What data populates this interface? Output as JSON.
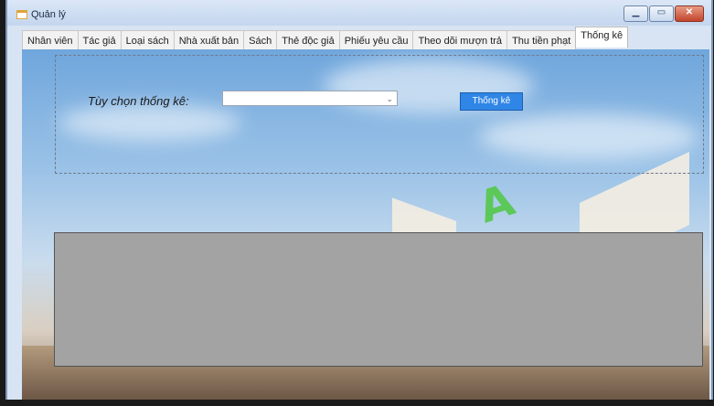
{
  "window": {
    "title": "Quản lý",
    "icon": "app-form-icon",
    "controls": [
      "minimize-icon",
      "maximize-icon",
      "close-icon"
    ]
  },
  "tabs": [
    {
      "label": "Nhân viên",
      "active": false
    },
    {
      "label": "Tác giả",
      "active": false
    },
    {
      "label": "Loại sách",
      "active": false
    },
    {
      "label": "Nhà xuất bản",
      "active": false
    },
    {
      "label": "Sách",
      "active": false
    },
    {
      "label": "Thẻ độc giả",
      "active": false
    },
    {
      "label": "Phiếu yêu cầu",
      "active": false
    },
    {
      "label": "Theo dõi mượn trả",
      "active": false
    },
    {
      "label": "Thu tiền phạt",
      "active": false
    },
    {
      "label": "Thống kê",
      "active": true
    }
  ],
  "stats": {
    "option_label": "Tùy chọn thống kê:",
    "combo_value": "",
    "button_label": "Thống kê"
  },
  "colors": {
    "button": "#2f86e6",
    "grid": "#a3a3a3",
    "letter": "#5cc85a"
  }
}
